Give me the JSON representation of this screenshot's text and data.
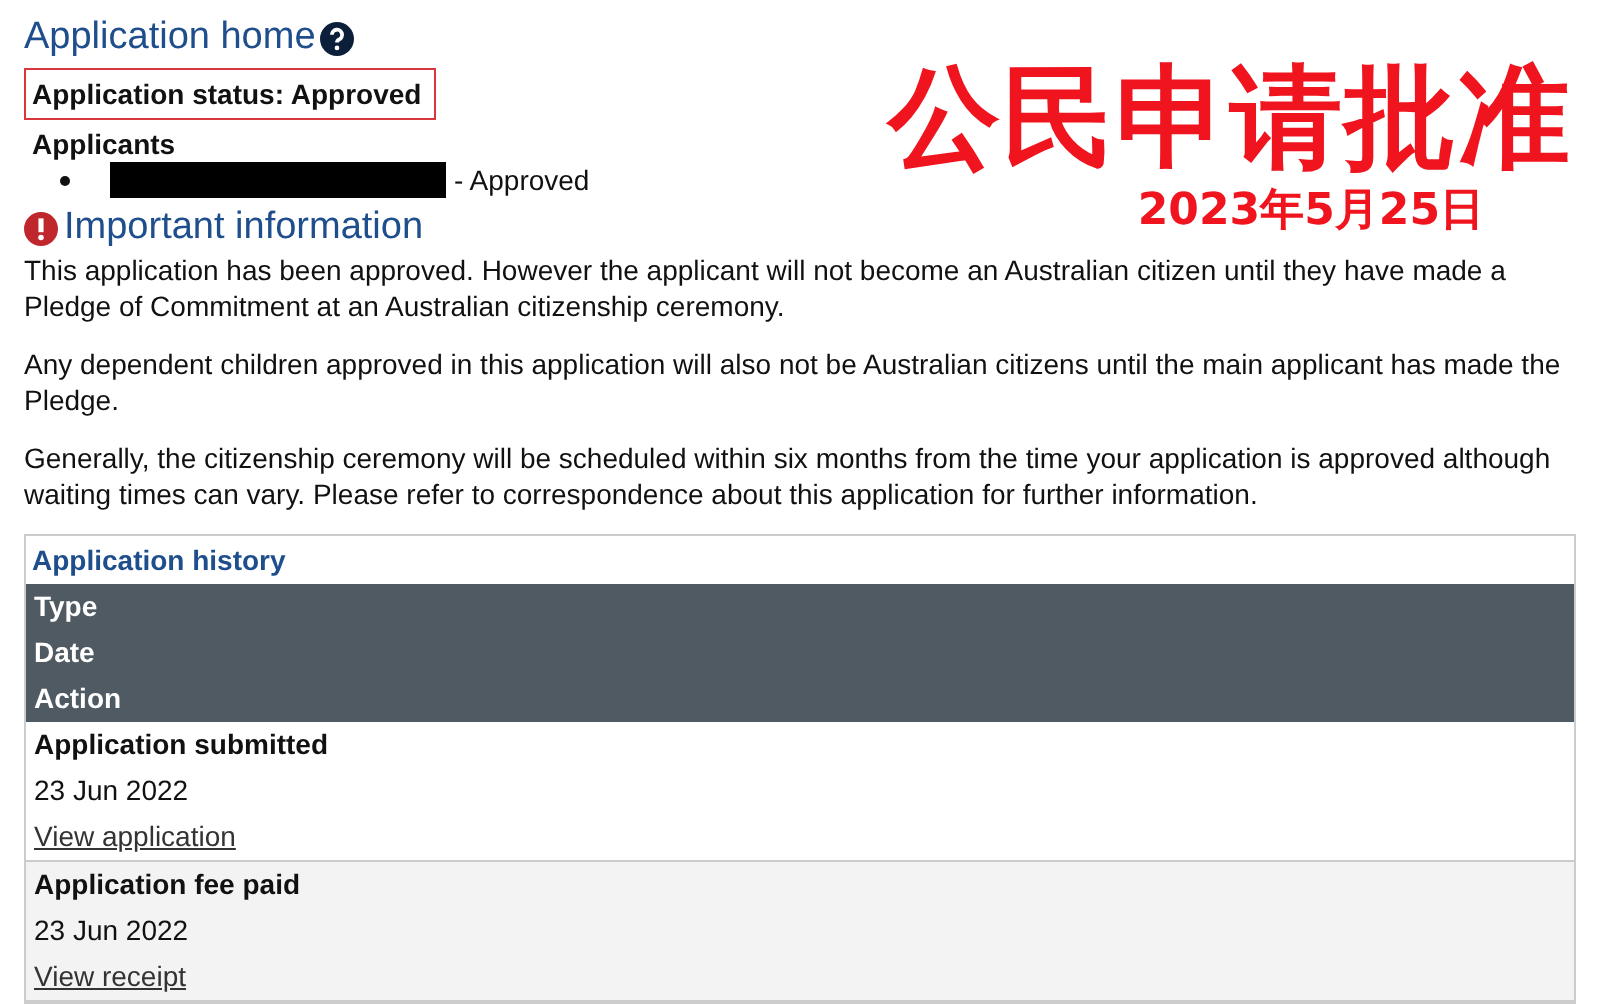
{
  "page": {
    "title": "Application home",
    "status": "Application status: Approved",
    "applicants_heading": "Applicants",
    "applicants": [
      {
        "status": "- Approved"
      }
    ]
  },
  "important": {
    "heading": "Important information",
    "paragraphs": [
      "This application has been approved. However the applicant will not become an Australian citizen until they have made a Pledge of Commitment at an Australian citizenship ceremony.",
      "Any dependent children approved in this application will also not be Australian citizens until the main applicant has made the Pledge.",
      "Generally, the citizenship ceremony will be scheduled within six months from the time your application is approved although waiting times can vary. Please refer to correspondence about this application for further information."
    ]
  },
  "overlay": {
    "headline": "公民申请批准",
    "date": "2023年5月25日"
  },
  "history": {
    "title": "Application history",
    "columns": [
      "Type",
      "Date",
      "Action"
    ],
    "rows": [
      {
        "type": "Application submitted",
        "date": "23 Jun 2022",
        "action": "View application"
      },
      {
        "type": "Application fee paid",
        "date": "23 Jun 2022",
        "action": "View receipt"
      }
    ]
  }
}
